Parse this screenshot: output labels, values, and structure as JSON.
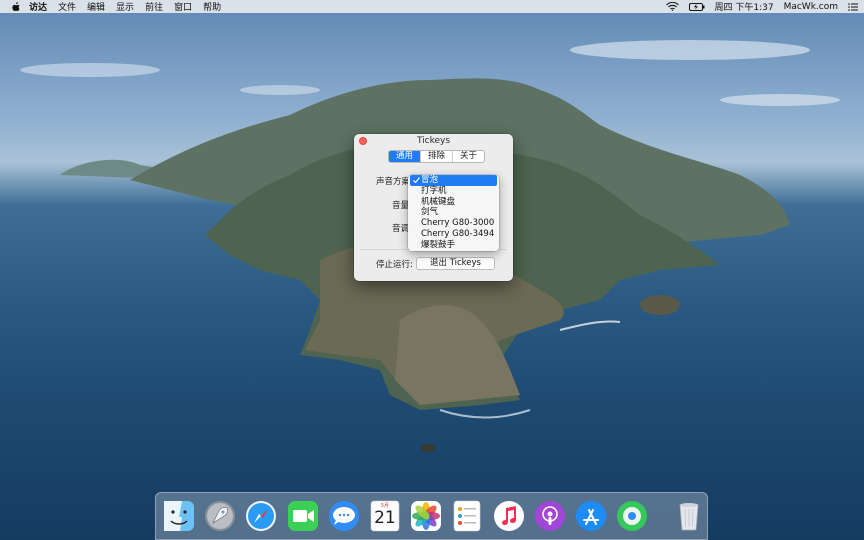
{
  "menubar": {
    "apple_icon": "apple-logo-icon",
    "items": [
      "访达",
      "文件",
      "编辑",
      "显示",
      "前往",
      "窗口",
      "帮助"
    ],
    "clock": "周四 下午1:37",
    "site": "MacWk.com",
    "status_icons": [
      "wifi-icon",
      "battery-icon",
      "list-menu-icon"
    ]
  },
  "window": {
    "title": "Tickeys",
    "tabs": [
      "通用",
      "排除",
      "关于"
    ],
    "active_tab": "通用",
    "sound_scheme_label": "声音方案:",
    "volume_label": "音量",
    "pitch_label": "音调",
    "stop_label": "停止运行:",
    "quit_button": "退出 Tickeys"
  },
  "dropdown": {
    "selected": "冒泡",
    "options": [
      "冒泡",
      "打字机",
      "机械键盘",
      "剑气",
      "Cherry G80-3000",
      "Cherry G80-3494",
      "爆裂鼓手"
    ]
  },
  "dock": {
    "apps": [
      "Finder",
      "Launchpad",
      "Safari",
      "FaceTime",
      "Messages",
      "Calendar",
      "Photos",
      "Reminders",
      "Music",
      "Podcasts",
      "App Store",
      "Find My",
      "Trash"
    ],
    "calendar_month": "5月",
    "calendar_day": "21"
  },
  "colors": {
    "accent": "#1f7cf5",
    "close": "#fc5f57"
  }
}
